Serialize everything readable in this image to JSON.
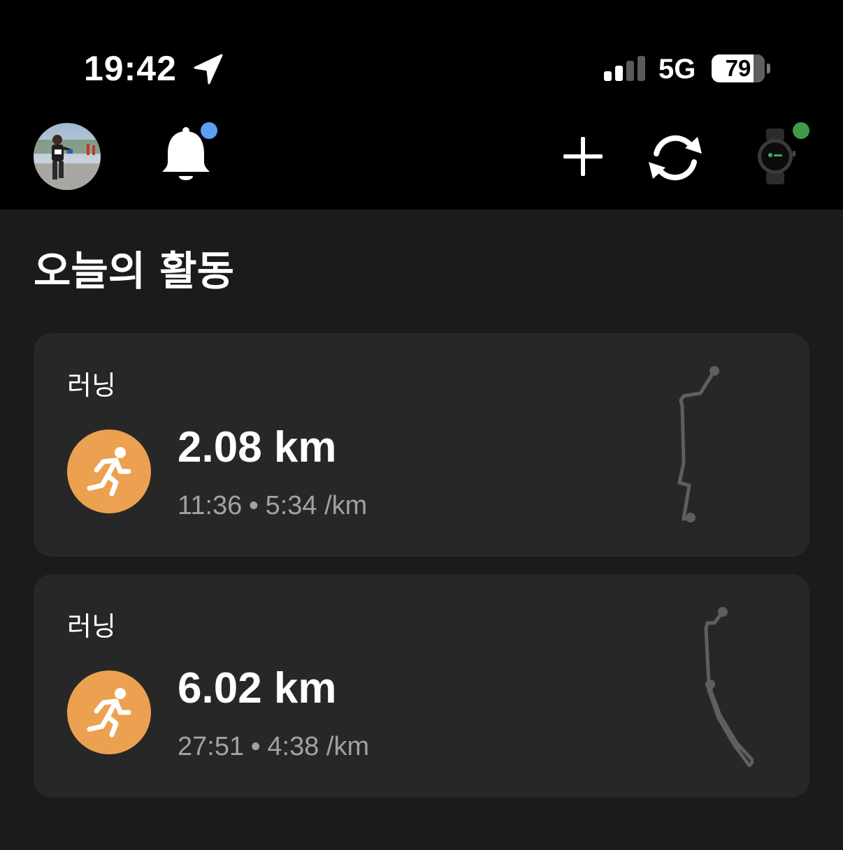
{
  "status_bar": {
    "time": "19:42",
    "location_icon": "location-arrow-icon",
    "signal_icon": "cellular-signal-icon",
    "signal_bars_active": 2,
    "signal_bars_total": 4,
    "network": "5G",
    "battery_percent": "79",
    "battery_level": 0.79
  },
  "header": {
    "avatar_icon": "user-avatar",
    "notification_icon": "bell-icon",
    "notification_dot_color": "#5b9ff0",
    "add_icon": "plus-icon",
    "sync_icon": "sync-icon",
    "device_icon": "smartwatch-icon",
    "device_status_color": "#3f9a4a"
  },
  "today": {
    "title": "오늘의 활동",
    "activities": [
      {
        "type": "러닝",
        "icon": "running-icon",
        "distance": "2.08 km",
        "duration": "11:36",
        "separator": "•",
        "pace": "5:34 /km"
      },
      {
        "type": "러닝",
        "icon": "running-icon",
        "distance": "6.02 km",
        "duration": "27:51",
        "separator": "•",
        "pace": "4:38 /km"
      }
    ]
  },
  "colors": {
    "background": "#1b1b1b",
    "top_bar": "#000000",
    "card": "#272727",
    "run_accent": "#eba150",
    "secondary_text": "#a2a2a2",
    "route_line": "#5f5f5f"
  }
}
